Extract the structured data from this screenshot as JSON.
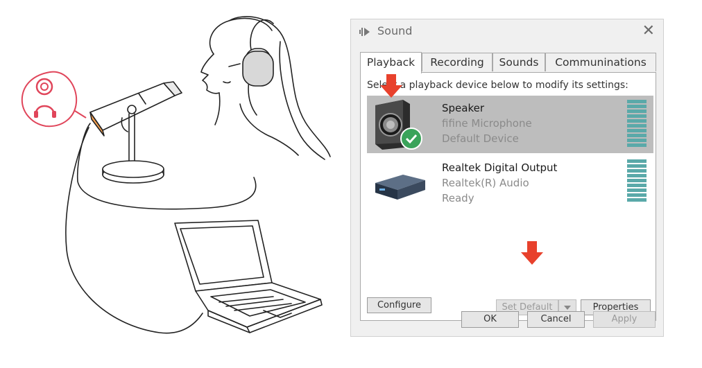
{
  "dialog": {
    "title": "Sound",
    "close_glyph": "✕",
    "tabs": [
      {
        "label": "Playback",
        "active": true
      },
      {
        "label": "Recording",
        "active": false
      },
      {
        "label": "Sounds",
        "active": false
      },
      {
        "label": "Communinations",
        "active": false
      }
    ],
    "instruction": "Select a playback device below to modify its settings:",
    "devices": [
      {
        "name": "Speaker",
        "line1": "fifine Microphone",
        "line2": "Default Device",
        "selected": true,
        "icon": "speaker-icon",
        "status_icon": "default-check-icon"
      },
      {
        "name": "Realtek Digital Output",
        "line1": "Realtek(R) Audio",
        "line2": "Ready",
        "selected": false,
        "icon": "digital-output-icon"
      }
    ],
    "buttons": {
      "configure": "Configure",
      "set_default": "Set Default",
      "properties": "Properties",
      "ok": "OK",
      "cancel": "Cancel",
      "apply": "Apply"
    }
  },
  "colors": {
    "arrow": "#e8412c",
    "check": "#3aa35a",
    "meter": "#5aa9a9",
    "accent_pink": "#e0455a"
  },
  "illustration": {
    "icons": [
      "microphone-icon",
      "headphones-icon",
      "laptop-icon",
      "person-with-headphones"
    ]
  }
}
